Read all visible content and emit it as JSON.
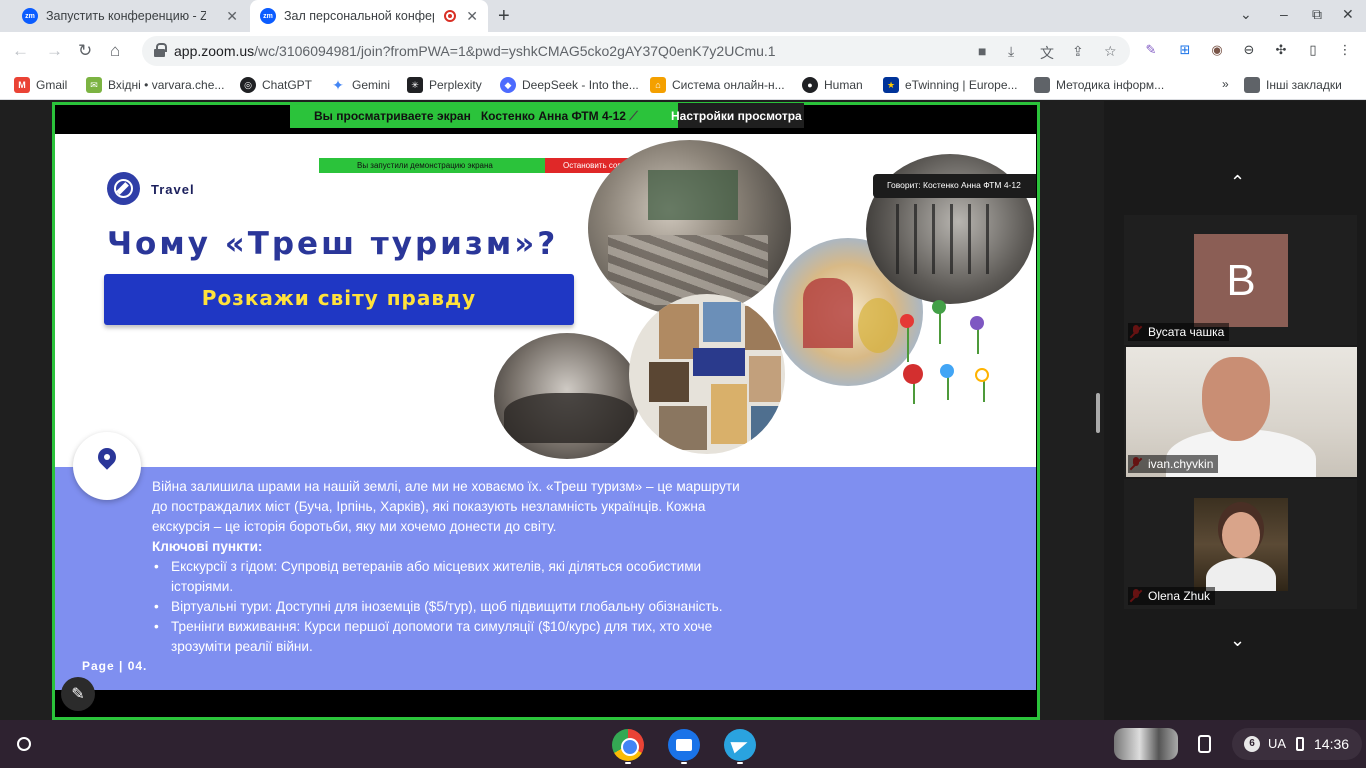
{
  "browser": {
    "tabs": [
      {
        "title": "Запустить конференцию - Zoom",
        "active": false
      },
      {
        "title": "Зал персональной конференции",
        "active": true
      }
    ],
    "new_tab_symbol": "+",
    "window_controls": [
      "⌄",
      "–",
      "⧉",
      "✕"
    ],
    "url_host": "app.zoom.us",
    "url_path": "/wc/3106094981/join?fromPWA=1&pwd=yshkCMAG5cko2gAY37Q0enK7y2UCmu.1",
    "bookmarks": [
      {
        "label": "Gmail",
        "icon": "gmail-icon",
        "color": "#ea4335"
      },
      {
        "label": "Вхідні • varvara.che...",
        "icon": "mail-icon",
        "color": "#7cb342"
      },
      {
        "label": "ChatGPT",
        "icon": "chatgpt-icon",
        "color": "#202124"
      },
      {
        "label": "Gemini",
        "icon": "gemini-icon",
        "color": "#4285f4"
      },
      {
        "label": "Perplexity",
        "icon": "perplexity-icon",
        "color": "#202124"
      },
      {
        "label": "DeepSeek - Into the...",
        "icon": "deepseek-icon",
        "color": "#4d6bfe"
      },
      {
        "label": "Система онлайн-н...",
        "icon": "school-icon",
        "color": "#f4a000"
      },
      {
        "label": "Human",
        "icon": "human-icon",
        "color": "#202124"
      },
      {
        "label": "eTwinning | Europe...",
        "icon": "eu-flag-icon",
        "color": "#003399"
      },
      {
        "label": "Методика інформ...",
        "icon": "folder-icon",
        "color": "#5f6368"
      }
    ],
    "bookmarks_more": "»",
    "other_bookmarks": "Інші закладки"
  },
  "zoom": {
    "view_bar": {
      "viewing_label": "Вы просматриваете экран",
      "presenter": "Костенко Анна ФТМ 4-12",
      "settings_label": "Настройки просмотра"
    },
    "participants": [
      {
        "name": "Вусата чашка",
        "initial": "B",
        "muted": true
      },
      {
        "name": "ivan.chyvkin",
        "muted": true
      },
      {
        "name": "Olena Zhuk",
        "muted": true
      }
    ],
    "scroll_up": "⌃",
    "scroll_down": "⌄"
  },
  "slide": {
    "mini_share_label": "Вы запустили демонстрацию экрана",
    "mini_stop_label": "Остановить совместное использование",
    "speaker_tag": "Говорит: Костенко Анна ФТМ 4-12",
    "brand": "Travel",
    "title": "Чому «Треш туризм»?",
    "banner": "Розкажи світу правду",
    "intro": "Війна залишила шрами на нашій землі, але ми не ховаємо їх. «Треш туризм» – це маршрути до постраждалих міст (Буча, Ірпінь, Харків), які показують незламність українців. Кожна екскурсія – це історія боротьби, яку ми хочемо донести до світу.",
    "key_points_label": "Ключові пункти:",
    "points": [
      "Екскурсії з гідом: Супровід ветеранів або місцевих жителів, які діляться особистими історіями.",
      "Віртуальні тури: Доступні для іноземців ($5/тур), щоб підвищити глобальну обізнаність.",
      "Тренінги виживання: Курси першої допомоги та симуляції ($10/курс) для тих, хто хоче зрозуміти реалії війни."
    ],
    "page_label": "Page | 04."
  },
  "shelf": {
    "tray_count": "6",
    "lang": "UA",
    "time": "14:36"
  },
  "colors": {
    "zoom_green": "#2bc33b",
    "slide_blue": "#2a3699",
    "banner_blue": "#1f37c4",
    "banner_text": "#ffe23b",
    "panel_periwinkle": "#7f8ff0",
    "stop_red": "#e02828"
  }
}
